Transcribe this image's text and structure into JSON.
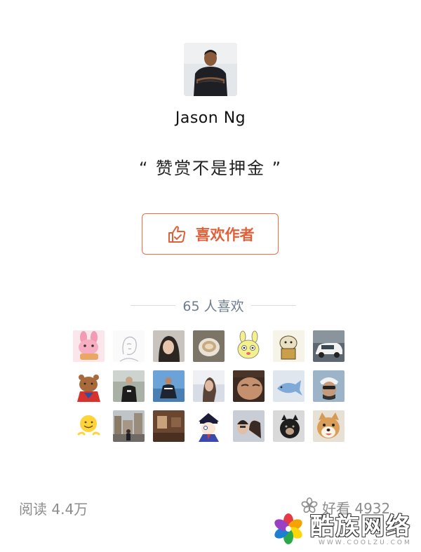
{
  "author": {
    "name": "Jason Ng",
    "avatar_icon": "author-photo"
  },
  "reward": {
    "slogan": "“ 赞赏不是押金 ”"
  },
  "like_button": {
    "label": "喜欢作者",
    "icon": "thumbs-up-icon",
    "color": "#e0603a"
  },
  "likes": {
    "summary": "65 人喜欢",
    "avatars": [
      {
        "icon": "pink-rabbit-avatar"
      },
      {
        "icon": "sketch-portrait-avatar"
      },
      {
        "icon": "woman-portrait-avatar"
      },
      {
        "icon": "coffee-cup-avatar"
      },
      {
        "icon": "cartoon-bunny-avatar"
      },
      {
        "icon": "cartoon-dog-avatar"
      },
      {
        "icon": "white-car-avatar"
      },
      {
        "icon": "brown-bear-avatar"
      },
      {
        "icon": "man-standing-avatar"
      },
      {
        "icon": "man-outdoor-avatar"
      },
      {
        "icon": "woman-sunset-avatar"
      },
      {
        "icon": "face-closeup-avatar"
      },
      {
        "icon": "blue-fish-avatar"
      },
      {
        "icon": "cyclist-helmet-avatar"
      },
      {
        "icon": "smiley-emoji-avatar"
      },
      {
        "icon": "city-street-avatar"
      },
      {
        "icon": "brown-room-avatar"
      },
      {
        "icon": "anime-character-avatar"
      },
      {
        "icon": "couple-selfie-avatar"
      },
      {
        "icon": "black-dog-avatar"
      },
      {
        "icon": "shiba-dog-avatar"
      }
    ]
  },
  "stats": {
    "reads": "阅读 4.4万",
    "wow": "好看 4932",
    "wow_icon": "flower-icon"
  },
  "watermark": {
    "title": "酷族网络",
    "url": "WWW.COOLZU.COM"
  }
}
